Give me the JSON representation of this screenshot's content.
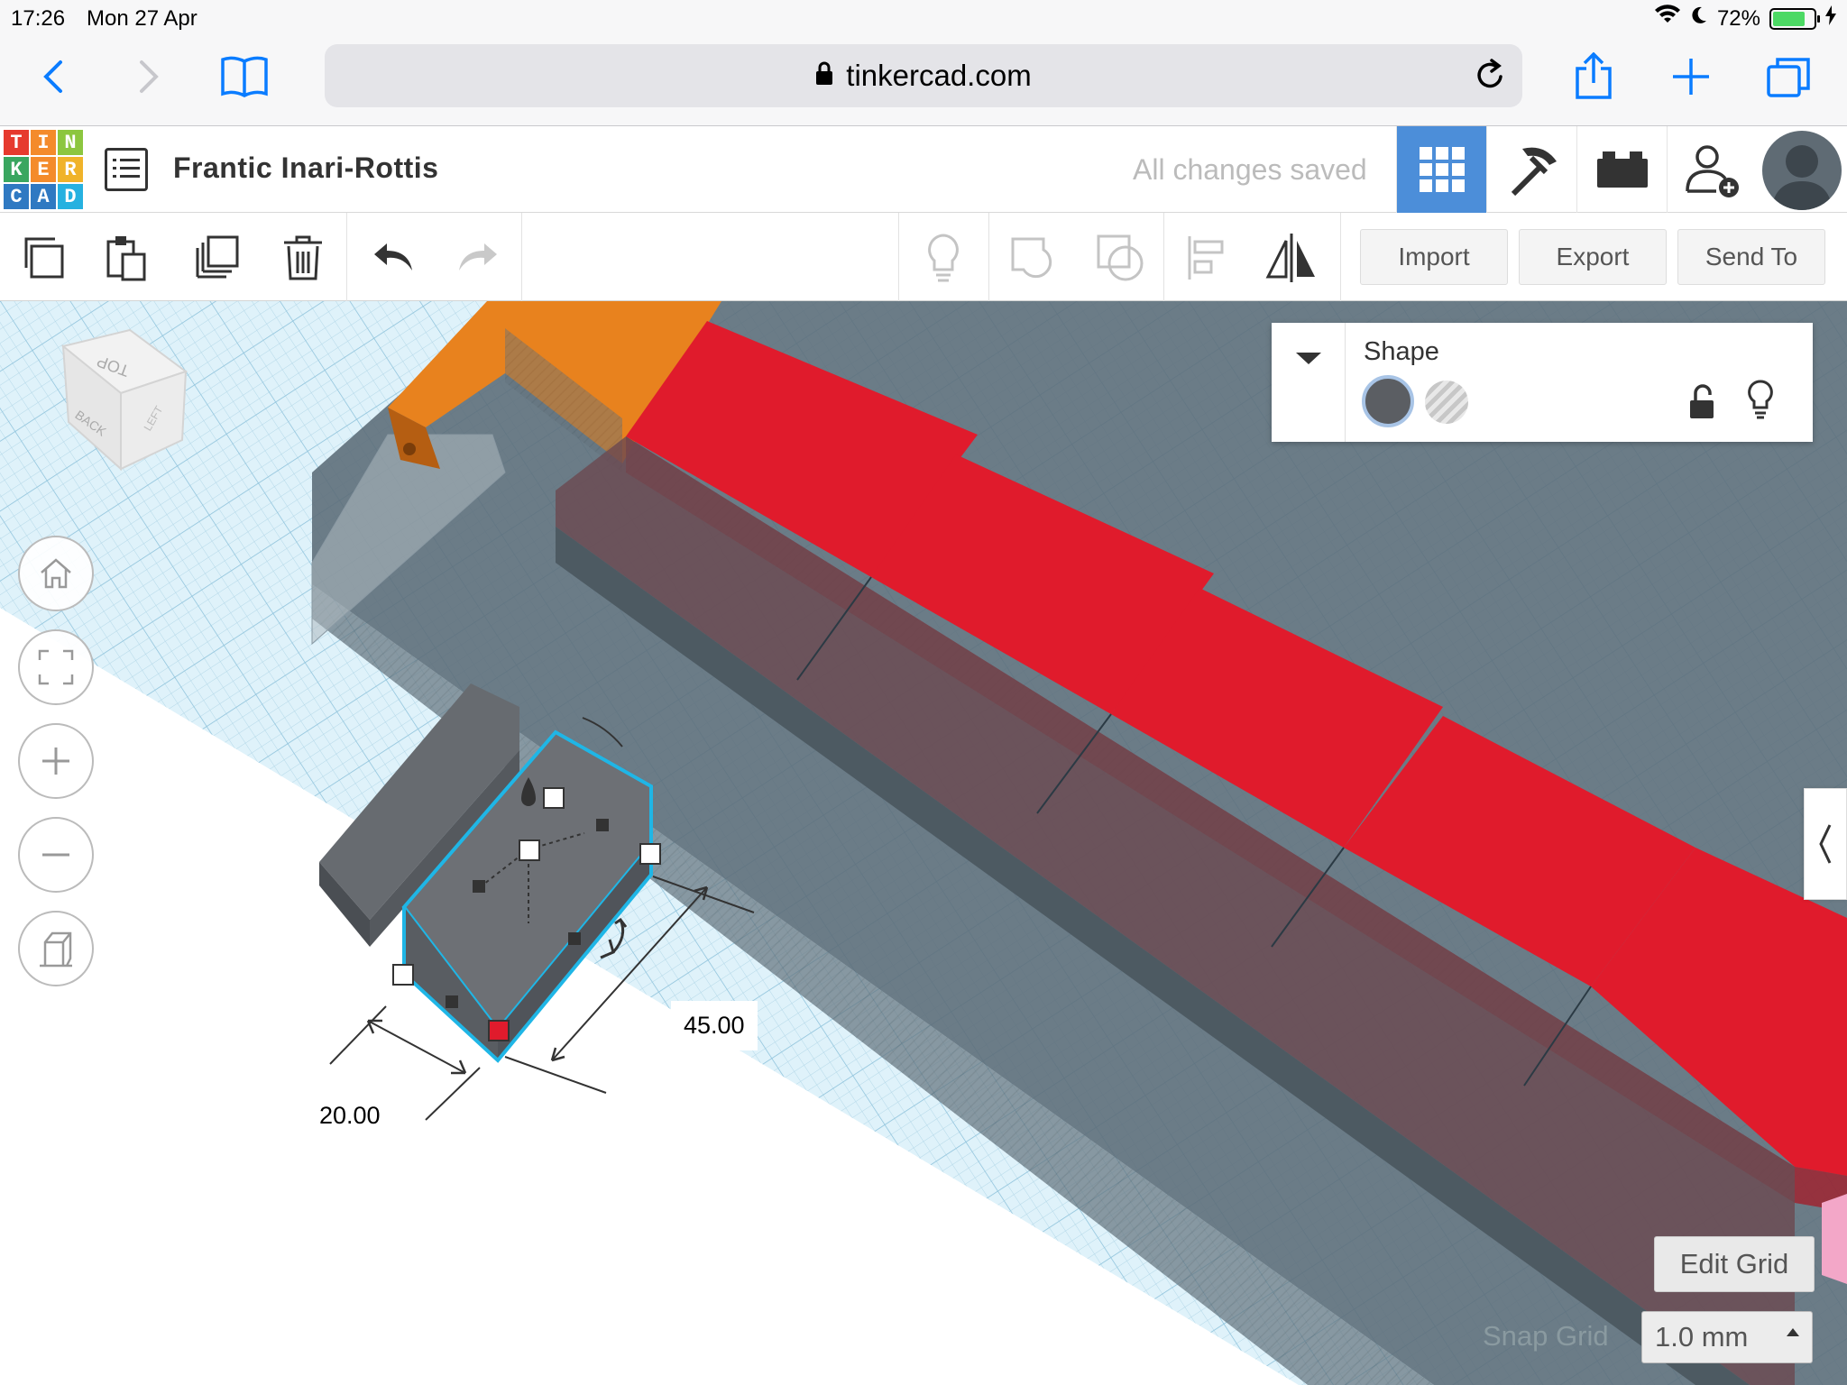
{
  "status_bar": {
    "time": "17:26",
    "date": "Mon 27 Apr",
    "battery_percent": "72%",
    "battery_level": 0.72
  },
  "browser": {
    "url": "tinkercad.com"
  },
  "header": {
    "logo_letters": [
      "T",
      "I",
      "N",
      "K",
      "E",
      "R",
      "C",
      "A",
      "D"
    ],
    "project_title": "Frantic Inari-Rottis",
    "save_status": "All changes saved"
  },
  "toolbar": {
    "import_label": "Import",
    "export_label": "Export",
    "send_to_label": "Send To"
  },
  "shape_panel": {
    "title": "Shape"
  },
  "viewcube": {
    "face_top": "TOP",
    "face_back": "BACK",
    "face_left": "LEFT"
  },
  "dimensions": {
    "width": "20.00",
    "length": "45.00"
  },
  "grid_controls": {
    "edit_grid_label": "Edit Grid",
    "snap_grid_label": "Snap Grid",
    "snap_value": "1.0 mm"
  },
  "colors": {
    "accent": "#4c8ed9",
    "workplane": "#dff2fa",
    "red_box": "#e01b2c",
    "orange_box": "#e8821e",
    "gray_solid": "#5b5e63",
    "selection": "#1fb6e6"
  }
}
